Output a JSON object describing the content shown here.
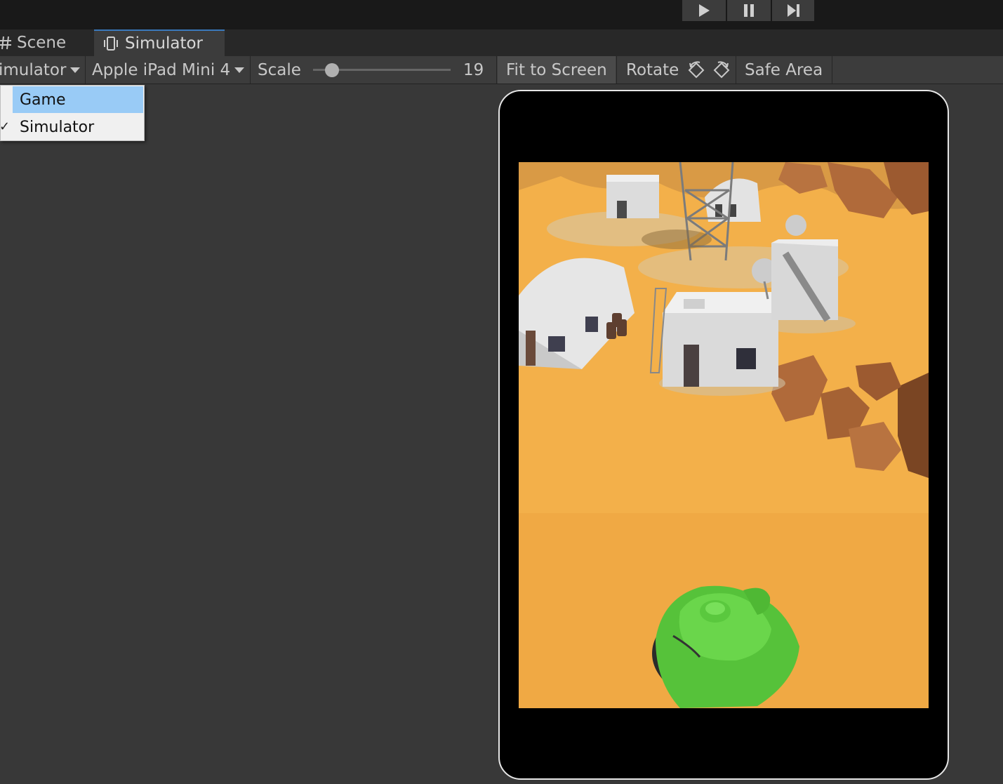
{
  "tabs": [
    {
      "label": "Scene",
      "icon": "hash-icon"
    },
    {
      "label": "Simulator",
      "icon": "device-icon"
    }
  ],
  "play_controls": [
    "play-icon",
    "pause-icon",
    "step-icon"
  ],
  "toolbar": {
    "mode_label": "imulator",
    "device_label": "Apple iPad Mini 4",
    "scale_label": "Scale",
    "scale_value": "19",
    "scale_fraction": 0.14,
    "fit_label": "Fit to Screen",
    "rotate_label": "Rotate",
    "safe_area_label": "Safe Area"
  },
  "mode_menu": {
    "items": [
      {
        "label": "Game",
        "highlighted": true,
        "checked": false
      },
      {
        "label": "Simulator",
        "highlighted": false,
        "checked": true
      }
    ]
  },
  "colors": {
    "accent": "#3a79bb",
    "menu_highlight": "#99cbf6",
    "ground": "#f3b04a",
    "tank": "#6ad64b",
    "rock": "#b06a3a"
  }
}
